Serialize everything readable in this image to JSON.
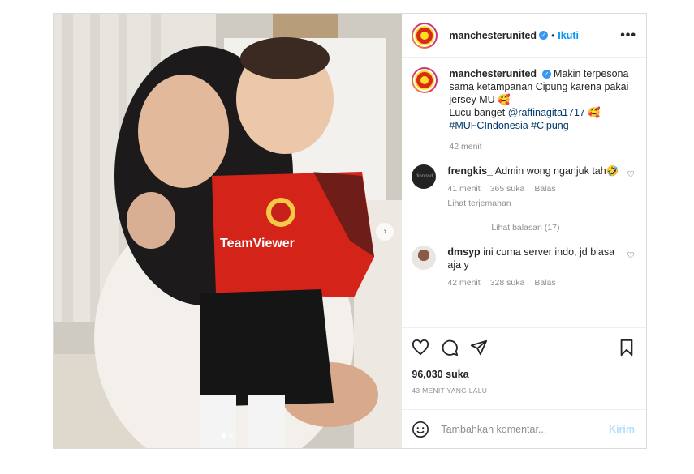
{
  "post": {
    "username": "manchesterunited",
    "follow_label": "Ikuti",
    "separator": "•",
    "more_label": "•••",
    "verified_mark": "✓",
    "caption_line1": "Makin terpesona sama ketampanan Cipung karena pakai jersey MU 🥰",
    "caption_line2_prefix": "Lucu banget ",
    "caption_mention": "@raffinagita1717",
    "caption_line2_suffix": " 🥰",
    "hashtags": "#MUFCIndonesia #Cipung",
    "caption_time": "42 menit",
    "likes": "96,030 suka",
    "posted_ago": "43 MENIT YANG LALU",
    "add_comment_placeholder": "Tambahkan komentar...",
    "post_button": "Kirim",
    "media_dots": 2,
    "next_arrow": "›"
  },
  "comments": [
    {
      "username": "frengkis_",
      "text": "Admin wong nganjuk tah🤣",
      "time": "41 menit",
      "likes": "365 suka",
      "reply": "Balas",
      "translate": "Lihat terjemahan",
      "avatar_text": "dinnnnd",
      "view_replies": "Lihat balasan (17)"
    },
    {
      "username": "dmsyp",
      "text": "ini cuma server indo, jd biasa aja y",
      "time": "42 menit",
      "likes": "328 suka",
      "reply": "Balas"
    }
  ],
  "icons": {
    "heart": "heart-icon",
    "comment": "comment-icon",
    "share": "share-icon",
    "save": "bookmark-icon",
    "emoji": "emoji-icon"
  },
  "colors": {
    "link": "#00376b",
    "follow": "#0095f6",
    "verified": "#3897f0",
    "jersey_red": "#da291c",
    "muted": "#8e8e8e"
  },
  "jersey_text": "TeamViewer"
}
